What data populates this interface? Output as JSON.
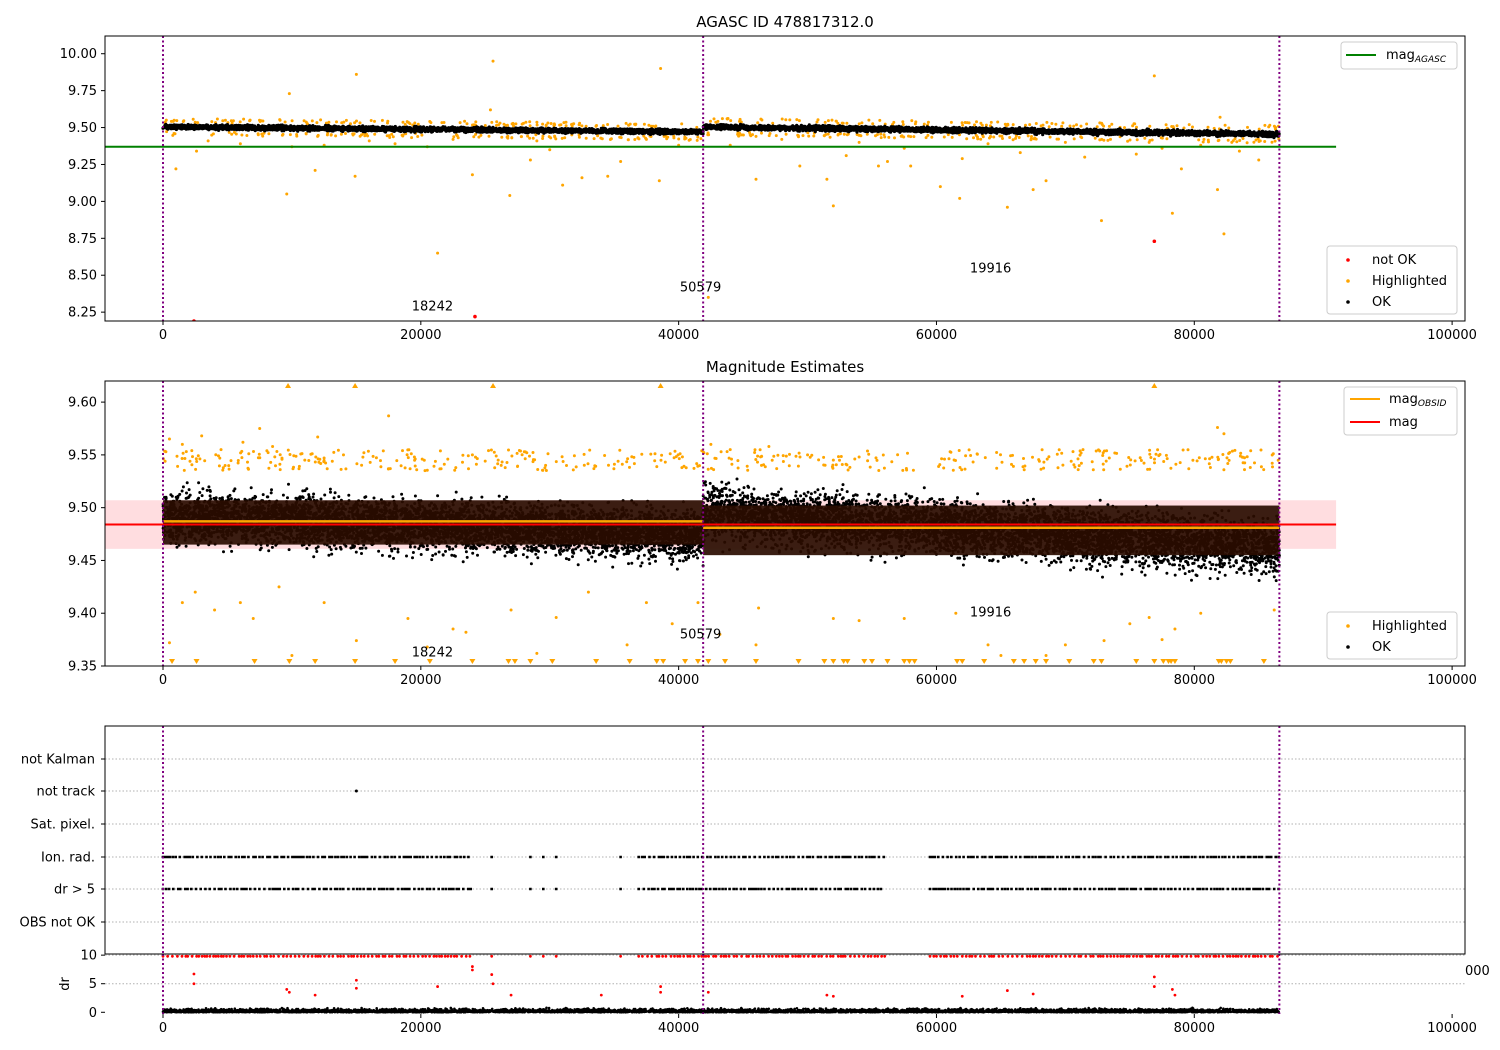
{
  "chart_data": [
    {
      "type": "scatter",
      "title": "AGASC ID 478817312.0",
      "xlim": [
        -4500,
        101000
      ],
      "ylim": [
        8.19,
        10.12
      ],
      "xticks": [
        0,
        20000,
        40000,
        60000,
        80000,
        100000
      ],
      "yticks": [
        8.25,
        8.5,
        8.75,
        9.0,
        9.25,
        9.5,
        9.75,
        10.0
      ],
      "ytick_labels": [
        "8.25",
        "8.50",
        "8.75",
        "9.00",
        "9.25",
        "9.50",
        "9.75",
        "10.00"
      ],
      "obsid_boundaries": [
        0,
        41900,
        86600
      ],
      "obsid_labels": [
        {
          "text": "18242",
          "x": 20900,
          "y": 8.26
        },
        {
          "text": "50579",
          "x": 41700,
          "y": 8.39
        },
        {
          "text": "19916",
          "x": 64200,
          "y": 8.52
        }
      ],
      "mag_agasc": 9.37,
      "legend_lines": [
        {
          "label": "mag",
          "sub": "AGASC",
          "color": "#008000"
        }
      ],
      "legend_points": [
        {
          "label": "not OK",
          "color": "#ff0000"
        },
        {
          "label": "Highlighted",
          "color": "#ffa500"
        },
        {
          "label": "OK",
          "color": "#000000"
        }
      ],
      "ok_band": [
        {
          "x0": 0,
          "x1": 41900,
          "y_start": 9.505,
          "y_end": 9.47,
          "halfwidth": 0.02
        },
        {
          "x0": 41900,
          "x1": 86600,
          "y_start": 9.505,
          "y_end": 9.455,
          "halfwidth": 0.022
        }
      ],
      "highlighted_points": [
        [
          1000,
          9.22
        ],
        [
          2600,
          9.34
        ],
        [
          3500,
          9.41
        ],
        [
          6000,
          9.39
        ],
        [
          9800,
          9.73
        ],
        [
          9600,
          9.05
        ],
        [
          10000,
          9.37
        ],
        [
          11800,
          9.21
        ],
        [
          12500,
          9.38
        ],
        [
          15000,
          9.86
        ],
        [
          14900,
          9.17
        ],
        [
          16000,
          9.41
        ],
        [
          18000,
          9.39
        ],
        [
          20500,
          9.37
        ],
        [
          21300,
          8.65
        ],
        [
          22500,
          9.42
        ],
        [
          24000,
          9.18
        ],
        [
          25600,
          9.95
        ],
        [
          25400,
          9.62
        ],
        [
          26900,
          9.04
        ],
        [
          28500,
          9.28
        ],
        [
          29000,
          9.41
        ],
        [
          31000,
          9.11
        ],
        [
          30000,
          9.35
        ],
        [
          32500,
          9.16
        ],
        [
          34500,
          9.17
        ],
        [
          35500,
          9.27
        ],
        [
          37500,
          9.42
        ],
        [
          38600,
          9.9
        ],
        [
          38500,
          9.14
        ],
        [
          40000,
          9.38
        ],
        [
          42300,
          8.35
        ],
        [
          44000,
          9.38
        ],
        [
          46000,
          9.15
        ],
        [
          48000,
          9.42
        ],
        [
          49400,
          9.24
        ],
        [
          51500,
          9.15
        ],
        [
          52000,
          8.97
        ],
        [
          53000,
          9.31
        ],
        [
          54000,
          9.4
        ],
        [
          55500,
          9.24
        ],
        [
          56200,
          9.27
        ],
        [
          57500,
          9.36
        ],
        [
          58000,
          9.24
        ],
        [
          60300,
          9.1
        ],
        [
          61800,
          9.02
        ],
        [
          62000,
          9.29
        ],
        [
          64000,
          9.39
        ],
        [
          65500,
          8.96
        ],
        [
          66500,
          9.33
        ],
        [
          67500,
          9.08
        ],
        [
          68500,
          9.14
        ],
        [
          70000,
          9.4
        ],
        [
          71500,
          9.3
        ],
        [
          72800,
          8.87
        ],
        [
          73500,
          9.42
        ],
        [
          75500,
          9.32
        ],
        [
          76500,
          9.4
        ],
        [
          76900,
          9.85
        ],
        [
          77500,
          9.36
        ],
        [
          78300,
          8.92
        ],
        [
          79000,
          9.22
        ],
        [
          80500,
          9.38
        ],
        [
          81800,
          9.08
        ],
        [
          82000,
          9.57
        ],
        [
          82300,
          8.78
        ],
        [
          83500,
          9.34
        ],
        [
          85000,
          9.28
        ],
        [
          86300,
          9.5
        ]
      ],
      "not_ok_points": [
        [
          2400,
          8.19
        ],
        [
          24200,
          8.22
        ],
        [
          76900,
          8.73
        ]
      ]
    },
    {
      "type": "scatter",
      "title": "Magnitude Estimates",
      "xlim": [
        -4500,
        101000
      ],
      "ylim": [
        9.35,
        9.62
      ],
      "xticks": [
        0,
        20000,
        40000,
        60000,
        80000,
        100000
      ],
      "yticks": [
        9.35,
        9.4,
        9.45,
        9.5,
        9.55,
        9.6
      ],
      "ytick_labels": [
        "9.35",
        "9.40",
        "9.45",
        "9.50",
        "9.55",
        "9.60"
      ],
      "obsid_boundaries": [
        0,
        41900,
        86600
      ],
      "obsid_labels": [
        {
          "text": "18242",
          "x": 20900,
          "y": 9.359
        },
        {
          "text": "50579",
          "x": 41700,
          "y": 9.376
        },
        {
          "text": "19916",
          "x": 64200,
          "y": 9.397
        }
      ],
      "mag": 9.484,
      "mag_std": 0.023,
      "mag_obsid": [
        {
          "x0": 0,
          "x1": 41900,
          "y": 9.487
        },
        {
          "x0": 41900,
          "x1": 86600,
          "y": 9.481
        }
      ],
      "legend_lines": [
        {
          "label": "mag",
          "sub": "OBSID",
          "color": "#ffa500"
        },
        {
          "label": "mag",
          "sub": "",
          "color": "#ff0000"
        }
      ],
      "legend_points": [
        {
          "label": "Highlighted",
          "color": "#ffa500"
        },
        {
          "label": "OK",
          "color": "#000000"
        }
      ],
      "ok_band": [
        {
          "x0": 0,
          "x1": 41900,
          "y_start": 9.492,
          "y_end": 9.474,
          "halfwidth": 0.031
        },
        {
          "x0": 41900,
          "x1": 86600,
          "y_start": 9.495,
          "y_end": 9.462,
          "halfwidth": 0.034
        }
      ],
      "dark_band": [
        {
          "x0": 0,
          "x1": 41900,
          "y_lo": 9.465,
          "y_hi": 9.507
        },
        {
          "x0": 41900,
          "x1": 86600,
          "y_lo": 9.455,
          "y_hi": 9.502
        }
      ],
      "highlighted_points": [
        [
          500,
          9.565
        ],
        [
          1500,
          9.56
        ],
        [
          3000,
          9.568
        ],
        [
          4500,
          9.555
        ],
        [
          6200,
          9.562
        ],
        [
          7500,
          9.575
        ],
        [
          8500,
          9.558
        ],
        [
          11000,
          9.545
        ],
        [
          12000,
          9.567
        ],
        [
          14000,
          9.55
        ],
        [
          17500,
          9.587
        ],
        [
          19500,
          9.548
        ],
        [
          24000,
          9.55
        ],
        [
          26000,
          9.545
        ],
        [
          42500,
          9.56
        ],
        [
          44000,
          9.555
        ],
        [
          47000,
          9.558
        ],
        [
          50000,
          9.55
        ],
        [
          52000,
          9.545
        ],
        [
          54000,
          9.548
        ],
        [
          81800,
          9.576
        ],
        [
          82300,
          9.57
        ],
        [
          500,
          9.372
        ],
        [
          1500,
          9.41
        ],
        [
          2500,
          9.42
        ],
        [
          4000,
          9.403
        ],
        [
          6000,
          9.41
        ],
        [
          7000,
          9.395
        ],
        [
          9000,
          9.425
        ],
        [
          10000,
          9.36
        ],
        [
          12500,
          9.41
        ],
        [
          15000,
          9.374
        ],
        [
          19000,
          9.395
        ],
        [
          20500,
          9.368
        ],
        [
          22500,
          9.385
        ],
        [
          23500,
          9.382
        ],
        [
          27000,
          9.403
        ],
        [
          29000,
          9.362
        ],
        [
          30500,
          9.396
        ],
        [
          33000,
          9.42
        ],
        [
          36000,
          9.37
        ],
        [
          37500,
          9.41
        ],
        [
          39500,
          9.39
        ],
        [
          41500,
          9.41
        ],
        [
          43200,
          9.38
        ],
        [
          46000,
          9.37
        ],
        [
          46200,
          9.405
        ],
        [
          52000,
          9.395
        ],
        [
          54000,
          9.393
        ],
        [
          57500,
          9.395
        ],
        [
          61500,
          9.4
        ],
        [
          64000,
          9.37
        ],
        [
          65000,
          9.36
        ],
        [
          68500,
          9.36
        ],
        [
          70000,
          9.37
        ],
        [
          73000,
          9.374
        ],
        [
          75000,
          9.39
        ],
        [
          76500,
          9.396
        ],
        [
          77500,
          9.375
        ],
        [
          78500,
          9.385
        ],
        [
          80500,
          9.4
        ],
        [
          86200,
          9.403
        ]
      ],
      "upper_triangles": [
        9700,
        14900,
        25600,
        38600,
        76900
      ],
      "lower_triangles": [
        700,
        2600,
        7100,
        9800,
        11800,
        14900,
        18000,
        20700,
        24000,
        26800,
        27300,
        28500,
        30200,
        33600,
        36200,
        38300,
        38800,
        40500,
        41500,
        42300,
        43600,
        46000,
        49300,
        51300,
        52000,
        52800,
        53100,
        54400,
        55000,
        56200,
        57500,
        57900,
        58300,
        61600,
        62000,
        63700,
        66000,
        66800,
        67700,
        68500,
        70300,
        72200,
        72800,
        75500,
        76900,
        77600,
        78000,
        78200,
        78500,
        81900,
        82100,
        82500,
        82800,
        85400
      ]
    },
    {
      "type": "scatter",
      "title": "",
      "xlim": [
        -4500,
        101000
      ],
      "categories": [
        "not Kalman",
        "not track",
        "Sat. pixel.",
        "Ion. rad.",
        "dr > 5",
        "OBS not OK"
      ],
      "obsid_boundaries": [
        0,
        41900,
        86600
      ],
      "not_track_points": [
        15000
      ],
      "flag_segments": [
        [
          0,
          24000
        ],
        [
          36900,
          56000
        ],
        [
          59500,
          86600
        ]
      ],
      "flag_sparse": [
        25500,
        28500,
        29500,
        30500,
        35500
      ]
    },
    {
      "type": "scatter",
      "title": "",
      "xlim": [
        -4500,
        101000
      ],
      "ylim": [
        -0.3,
        10.2
      ],
      "xticks": [
        0,
        20000,
        40000,
        60000,
        80000,
        100000
      ],
      "yticks": [
        0,
        5,
        10
      ],
      "ytick_labels": [
        "0",
        "5",
        "10"
      ],
      "ylabel": "dr",
      "obsid_boundaries": [
        0,
        41900,
        86600
      ],
      "dr_segments": [
        [
          0,
          24000
        ],
        [
          36900,
          56000
        ],
        [
          59500,
          86600
        ]
      ],
      "dr_sparse": [
        25500,
        28500,
        29500,
        30500,
        35500
      ],
      "dr_outliers": [
        [
          2400,
          6.7
        ],
        [
          2400,
          5.0
        ],
        [
          9600,
          4.0
        ],
        [
          9800,
          3.5
        ],
        [
          11800,
          3.0
        ],
        [
          15000,
          5.6
        ],
        [
          15000,
          4.2
        ],
        [
          21300,
          4.5
        ],
        [
          24000,
          8.0
        ],
        [
          24000,
          7.4
        ],
        [
          25500,
          6.6
        ],
        [
          25600,
          5.0
        ],
        [
          27000,
          3.0
        ],
        [
          34000,
          3.0
        ],
        [
          38600,
          4.5
        ],
        [
          38600,
          3.5
        ],
        [
          42300,
          3.5
        ],
        [
          51500,
          3.0
        ],
        [
          52000,
          2.8
        ],
        [
          62000,
          2.8
        ],
        [
          65500,
          3.8
        ],
        [
          67500,
          3.2
        ],
        [
          76900,
          6.2
        ],
        [
          76900,
          4.5
        ],
        [
          78300,
          4.0
        ],
        [
          78500,
          3.0
        ]
      ]
    }
  ],
  "axis_fragment": "000"
}
